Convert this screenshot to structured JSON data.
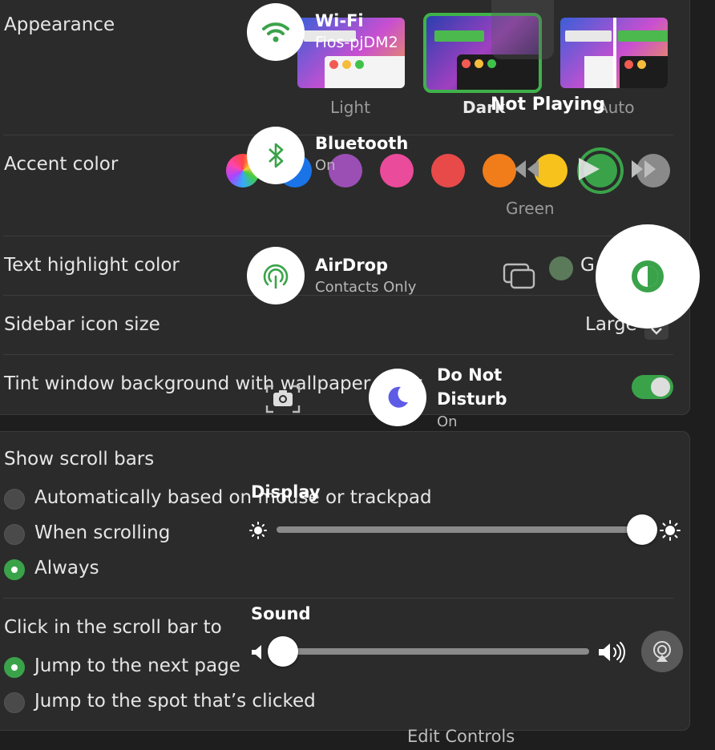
{
  "appearance": {
    "label": "Appearance",
    "options": [
      {
        "label": "Light"
      },
      {
        "label": "Dark"
      },
      {
        "label": "Auto"
      }
    ]
  },
  "accent": {
    "label": "Accent color",
    "selected_name": "Green",
    "colors": [
      "#ff4fa0",
      "#1a74e8",
      "#9b4fb4",
      "#ea4b9a",
      "#e84a4a",
      "#f07d1a",
      "#f7c21b",
      "#3aa34a",
      "#8a8a8a"
    ]
  },
  "highlight": {
    "label": "Text highlight color",
    "value_partial": "G"
  },
  "sidebar_size": {
    "label": "Sidebar icon size",
    "value": "Large"
  },
  "tint": {
    "label": "Tint window background with wallpaper color"
  },
  "scroll_bars": {
    "label": "Show scroll bars",
    "options": [
      {
        "label": "Automatically based on mouse or trackpad",
        "selected": false
      },
      {
        "label": "When scrolling",
        "selected": false
      },
      {
        "label": "Always",
        "selected": true
      }
    ]
  },
  "click_scroll": {
    "label": "Click in the scroll bar to",
    "options": [
      {
        "label": "Jump to the next page",
        "selected": true
      },
      {
        "label": "Jump to the spot that’s clicked",
        "selected": false
      }
    ]
  },
  "control_center": {
    "wifi": {
      "title": "Wi-Fi",
      "subtitle": "Fios-pjDM2"
    },
    "bluetooth": {
      "title": "Bluetooth",
      "subtitle": "On"
    },
    "airdrop": {
      "title": "AirDrop",
      "subtitle": "Contacts Only"
    },
    "focus": {
      "title_line1": "Do Not",
      "title_line2": "Disturb",
      "subtitle": "On"
    },
    "now_playing": {
      "label": "Not Playing"
    },
    "display": {
      "label": "Display",
      "level": 0.97
    },
    "sound": {
      "label": "Sound",
      "level": 0.0
    },
    "edit_controls": "Edit Controls"
  }
}
